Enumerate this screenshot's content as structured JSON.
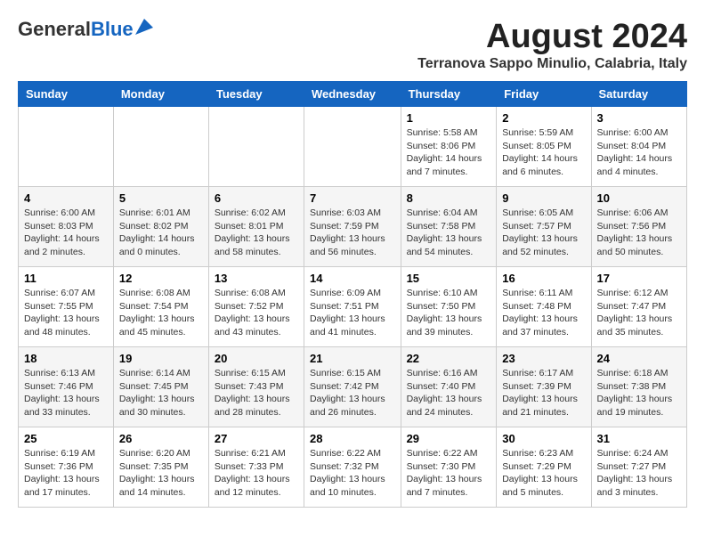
{
  "header": {
    "logo_general": "General",
    "logo_blue": "Blue",
    "month_title": "August 2024",
    "location": "Terranova Sappo Minulio, Calabria, Italy"
  },
  "days_of_week": [
    "Sunday",
    "Monday",
    "Tuesday",
    "Wednesday",
    "Thursday",
    "Friday",
    "Saturday"
  ],
  "weeks": [
    [
      {
        "day": "",
        "info": ""
      },
      {
        "day": "",
        "info": ""
      },
      {
        "day": "",
        "info": ""
      },
      {
        "day": "",
        "info": ""
      },
      {
        "day": "1",
        "info": "Sunrise: 5:58 AM\nSunset: 8:06 PM\nDaylight: 14 hours and 7 minutes."
      },
      {
        "day": "2",
        "info": "Sunrise: 5:59 AM\nSunset: 8:05 PM\nDaylight: 14 hours and 6 minutes."
      },
      {
        "day": "3",
        "info": "Sunrise: 6:00 AM\nSunset: 8:04 PM\nDaylight: 14 hours and 4 minutes."
      }
    ],
    [
      {
        "day": "4",
        "info": "Sunrise: 6:00 AM\nSunset: 8:03 PM\nDaylight: 14 hours and 2 minutes."
      },
      {
        "day": "5",
        "info": "Sunrise: 6:01 AM\nSunset: 8:02 PM\nDaylight: 14 hours and 0 minutes."
      },
      {
        "day": "6",
        "info": "Sunrise: 6:02 AM\nSunset: 8:01 PM\nDaylight: 13 hours and 58 minutes."
      },
      {
        "day": "7",
        "info": "Sunrise: 6:03 AM\nSunset: 7:59 PM\nDaylight: 13 hours and 56 minutes."
      },
      {
        "day": "8",
        "info": "Sunrise: 6:04 AM\nSunset: 7:58 PM\nDaylight: 13 hours and 54 minutes."
      },
      {
        "day": "9",
        "info": "Sunrise: 6:05 AM\nSunset: 7:57 PM\nDaylight: 13 hours and 52 minutes."
      },
      {
        "day": "10",
        "info": "Sunrise: 6:06 AM\nSunset: 7:56 PM\nDaylight: 13 hours and 50 minutes."
      }
    ],
    [
      {
        "day": "11",
        "info": "Sunrise: 6:07 AM\nSunset: 7:55 PM\nDaylight: 13 hours and 48 minutes."
      },
      {
        "day": "12",
        "info": "Sunrise: 6:08 AM\nSunset: 7:54 PM\nDaylight: 13 hours and 45 minutes."
      },
      {
        "day": "13",
        "info": "Sunrise: 6:08 AM\nSunset: 7:52 PM\nDaylight: 13 hours and 43 minutes."
      },
      {
        "day": "14",
        "info": "Sunrise: 6:09 AM\nSunset: 7:51 PM\nDaylight: 13 hours and 41 minutes."
      },
      {
        "day": "15",
        "info": "Sunrise: 6:10 AM\nSunset: 7:50 PM\nDaylight: 13 hours and 39 minutes."
      },
      {
        "day": "16",
        "info": "Sunrise: 6:11 AM\nSunset: 7:48 PM\nDaylight: 13 hours and 37 minutes."
      },
      {
        "day": "17",
        "info": "Sunrise: 6:12 AM\nSunset: 7:47 PM\nDaylight: 13 hours and 35 minutes."
      }
    ],
    [
      {
        "day": "18",
        "info": "Sunrise: 6:13 AM\nSunset: 7:46 PM\nDaylight: 13 hours and 33 minutes."
      },
      {
        "day": "19",
        "info": "Sunrise: 6:14 AM\nSunset: 7:45 PM\nDaylight: 13 hours and 30 minutes."
      },
      {
        "day": "20",
        "info": "Sunrise: 6:15 AM\nSunset: 7:43 PM\nDaylight: 13 hours and 28 minutes."
      },
      {
        "day": "21",
        "info": "Sunrise: 6:15 AM\nSunset: 7:42 PM\nDaylight: 13 hours and 26 minutes."
      },
      {
        "day": "22",
        "info": "Sunrise: 6:16 AM\nSunset: 7:40 PM\nDaylight: 13 hours and 24 minutes."
      },
      {
        "day": "23",
        "info": "Sunrise: 6:17 AM\nSunset: 7:39 PM\nDaylight: 13 hours and 21 minutes."
      },
      {
        "day": "24",
        "info": "Sunrise: 6:18 AM\nSunset: 7:38 PM\nDaylight: 13 hours and 19 minutes."
      }
    ],
    [
      {
        "day": "25",
        "info": "Sunrise: 6:19 AM\nSunset: 7:36 PM\nDaylight: 13 hours and 17 minutes."
      },
      {
        "day": "26",
        "info": "Sunrise: 6:20 AM\nSunset: 7:35 PM\nDaylight: 13 hours and 14 minutes."
      },
      {
        "day": "27",
        "info": "Sunrise: 6:21 AM\nSunset: 7:33 PM\nDaylight: 13 hours and 12 minutes."
      },
      {
        "day": "28",
        "info": "Sunrise: 6:22 AM\nSunset: 7:32 PM\nDaylight: 13 hours and 10 minutes."
      },
      {
        "day": "29",
        "info": "Sunrise: 6:22 AM\nSunset: 7:30 PM\nDaylight: 13 hours and 7 minutes."
      },
      {
        "day": "30",
        "info": "Sunrise: 6:23 AM\nSunset: 7:29 PM\nDaylight: 13 hours and 5 minutes."
      },
      {
        "day": "31",
        "info": "Sunrise: 6:24 AM\nSunset: 7:27 PM\nDaylight: 13 hours and 3 minutes."
      }
    ]
  ]
}
